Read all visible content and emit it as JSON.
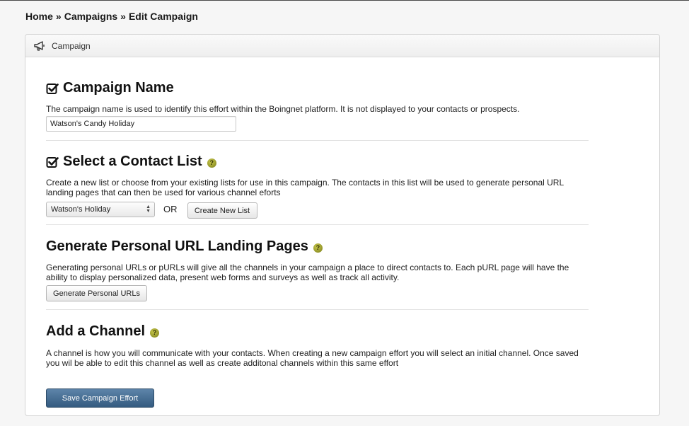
{
  "breadcrumb": {
    "home": "Home",
    "separator": "»",
    "campaigns": "Campaigns",
    "current": "Edit Campaign"
  },
  "panel": {
    "title": "Campaign",
    "icon": "megaphone-icon"
  },
  "campaign_name": {
    "title": "Campaign Name",
    "description": "The campaign name is used to identify this effort within the Boingnet platform. It is not displayed to your contacts or prospects.",
    "value": "Watson's Candy Holiday"
  },
  "contact_list": {
    "title": "Select a Contact List",
    "description": "Create a new list or choose from your existing lists for use in this campaign. The contacts in this list will be used to generate personal URL landing pages that can then be used for various channel eforts",
    "selected": "Watson's Holiday",
    "or_label": "OR",
    "create_button": "Create New List"
  },
  "purl": {
    "title": "Generate Personal URL Landing Pages",
    "description": "Generating personal URLs or pURLs will give all the channels in your campaign a place to direct contacts to. Each pURL page will have the ability to display personalized data, present web forms and surveys as well as track all activity.",
    "button": "Generate Personal URLs"
  },
  "channel": {
    "title": "Add a Channel",
    "description": "A channel is how you will communicate with your contacts. When creating a new campaign effort you will select an initial channel. Once saved you wil be able to edit this channel as well as create additonal channels within this same effort"
  },
  "save_button": "Save Campaign Effort",
  "colors": {
    "primary_button": "#456d93",
    "help_icon": "#9a9d2a"
  }
}
